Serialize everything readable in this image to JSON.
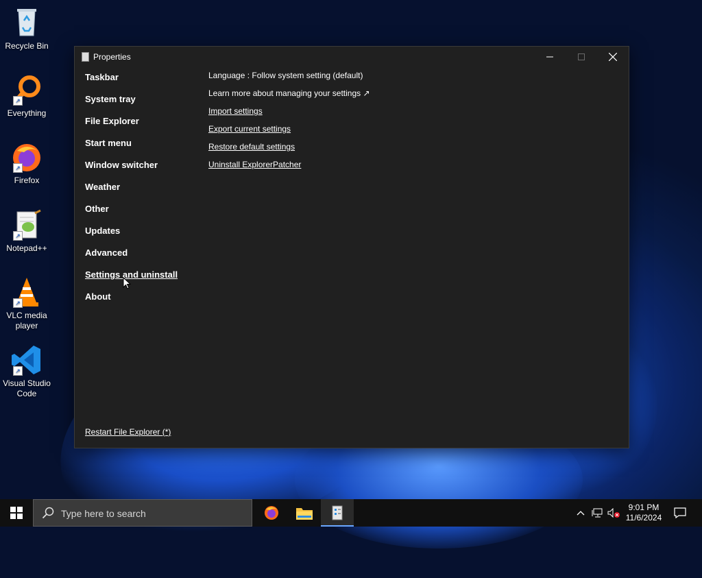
{
  "desktop": {
    "icons": [
      {
        "label": "Recycle Bin"
      },
      {
        "label": "Everything"
      },
      {
        "label": "Firefox"
      },
      {
        "label": "Notepad++"
      },
      {
        "label": "VLC media player"
      },
      {
        "label": "Visual Studio Code"
      }
    ]
  },
  "window": {
    "title": "Properties",
    "nav": [
      {
        "label": "Taskbar"
      },
      {
        "label": "System tray"
      },
      {
        "label": "File Explorer"
      },
      {
        "label": "Start menu"
      },
      {
        "label": "Window switcher"
      },
      {
        "label": "Weather"
      },
      {
        "label": "Other"
      },
      {
        "label": "Updates"
      },
      {
        "label": "Advanced"
      },
      {
        "label": "Settings and uninstall",
        "active": true
      },
      {
        "label": "About"
      }
    ],
    "content": {
      "language": "Language : Follow system setting (default)",
      "learn_more": "Learn more about managing your settings ↗",
      "import": "Import settings",
      "export": "Export current settings",
      "restore": "Restore default settings",
      "uninstall": "Uninstall ExplorerPatcher"
    },
    "restart": "Restart File Explorer (*)"
  },
  "taskbar": {
    "search_placeholder": "Type here to search",
    "time": "9:01 PM",
    "date": "11/6/2024"
  },
  "colors": {
    "window_bg": "#202020",
    "taskbar_bg": "#101010",
    "accent": "#6aa7ff"
  }
}
